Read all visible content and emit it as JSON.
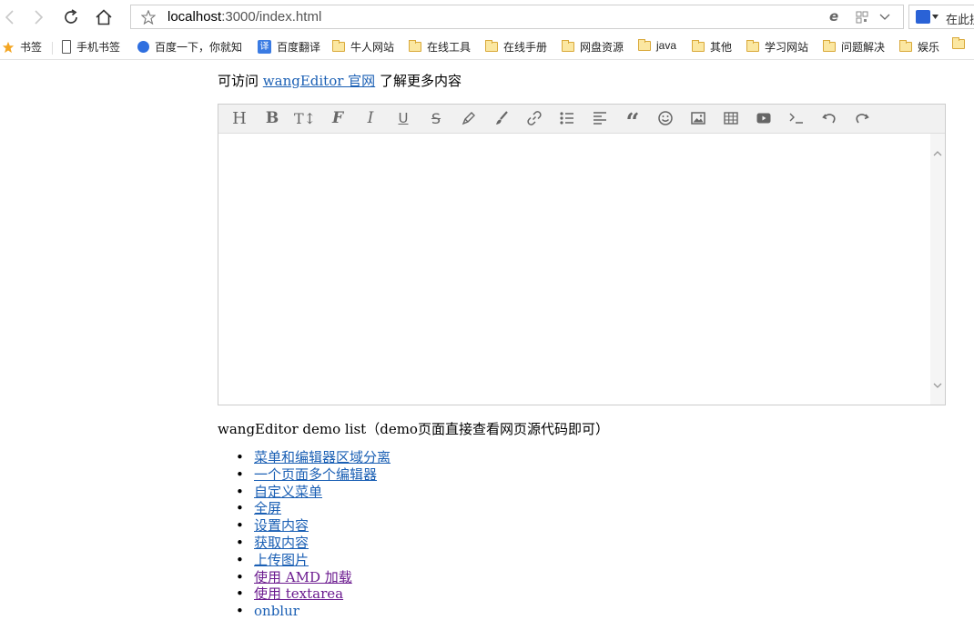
{
  "browser": {
    "url_host": "localhost",
    "url_rest": ":3000/index.html",
    "search_placeholder": "在此搜",
    "bookmarks": [
      {
        "label": "书签",
        "icon": "star-icon"
      },
      {
        "label": "手机书签",
        "icon": "phone-icon"
      },
      {
        "label": "百度一下，你就知",
        "icon": "baidu-paw-icon"
      },
      {
        "label": "百度翻译",
        "icon": "translate-icon"
      },
      {
        "label": "牛人网站",
        "icon": "folder-icon"
      },
      {
        "label": "在线工具",
        "icon": "folder-icon"
      },
      {
        "label": "在线手册",
        "icon": "folder-icon"
      },
      {
        "label": "网盘资源",
        "icon": "folder-icon"
      },
      {
        "label": "java",
        "icon": "folder-icon"
      },
      {
        "label": "其他",
        "icon": "folder-icon"
      },
      {
        "label": "学习网站",
        "icon": "folder-icon"
      },
      {
        "label": "问题解决",
        "icon": "folder-icon"
      },
      {
        "label": "娱乐",
        "icon": "folder-icon"
      }
    ]
  },
  "page": {
    "intro_before": "可访问 ",
    "intro_link": "wangEditor 官网",
    "intro_after": " 了解更多内容",
    "editor_menu": [
      "heading-icon",
      "bold-icon",
      "font-size-icon",
      "font-name-icon",
      "italic-icon",
      "underline-icon",
      "strikethrough-icon",
      "fore-color-icon",
      "back-color-icon",
      "link-icon",
      "list-icon",
      "justify-icon",
      "quote-icon",
      "emoticon-icon",
      "image-icon",
      "table-icon",
      "video-icon",
      "code-icon",
      "undo-icon",
      "redo-icon"
    ],
    "list_title": "wangEditor demo list（demo页面直接查看网页源代码即可）",
    "demos": [
      {
        "label": "菜单和编辑器区域分离",
        "visited": false
      },
      {
        "label": "一个页面多个编辑器",
        "visited": false
      },
      {
        "label": "自定义菜单",
        "visited": false
      },
      {
        "label": "全屏",
        "visited": false
      },
      {
        "label": "设置内容",
        "visited": false
      },
      {
        "label": "获取内容",
        "visited": false
      },
      {
        "label": "上传图片",
        "visited": false
      },
      {
        "label": "使用 AMD 加载",
        "visited": true
      },
      {
        "label": "使用 textarea",
        "visited": true
      },
      {
        "label": "onblur",
        "visited": false
      }
    ]
  },
  "colors": {
    "link": "#1a5fb4",
    "visited_link": "#6b1a8f",
    "menu_bg": "#f1f1f1"
  }
}
